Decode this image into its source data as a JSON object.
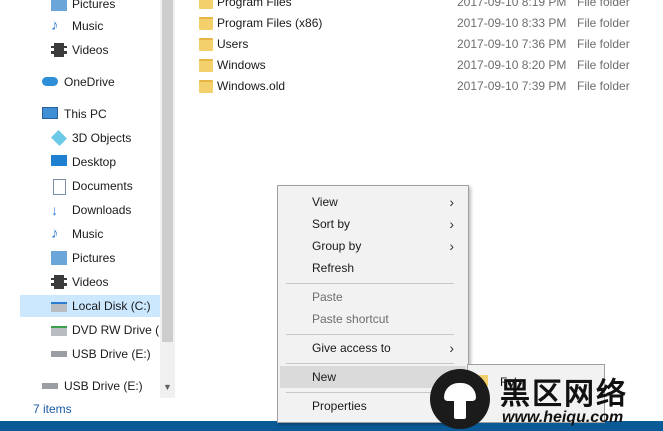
{
  "nav": {
    "items": [
      {
        "label": "Pictures"
      },
      {
        "label": "Music"
      },
      {
        "label": "Videos"
      },
      {
        "label": "OneDrive"
      },
      {
        "label": "This PC"
      },
      {
        "label": "3D Objects"
      },
      {
        "label": "Desktop"
      },
      {
        "label": "Documents"
      },
      {
        "label": "Downloads"
      },
      {
        "label": "Music"
      },
      {
        "label": "Pictures"
      },
      {
        "label": "Videos"
      },
      {
        "label": "Local Disk (C:)"
      },
      {
        "label": "DVD RW Drive (D"
      },
      {
        "label": "USB Drive (E:)"
      },
      {
        "label": "USB Drive (E:)"
      }
    ]
  },
  "files": [
    {
      "name": "Program Files",
      "date": "2017-09-10 8:19 PM",
      "type": "File folder"
    },
    {
      "name": "Program Files (x86)",
      "date": "2017-09-10 8:33 PM",
      "type": "File folder"
    },
    {
      "name": "Users",
      "date": "2017-09-10 7:36 PM",
      "type": "File folder"
    },
    {
      "name": "Windows",
      "date": "2017-09-10 8:20 PM",
      "type": "File folder"
    },
    {
      "name": "Windows.old",
      "date": "2017-09-10 7:39 PM",
      "type": "File folder"
    }
  ],
  "status": {
    "items": "7 items"
  },
  "menu": {
    "view": "View",
    "sort_by": "Sort by",
    "group_by": "Group by",
    "refresh": "Refresh",
    "paste": "Paste",
    "paste_shortcut": "Paste shortcut",
    "give_access": "Give access to",
    "new": "New",
    "properties": "Properties"
  },
  "submenu": {
    "folder": "Fol"
  },
  "watermark": {
    "text": "黑区网络",
    "url": "www.heiqu.com"
  },
  "colors": {
    "selection": "#cce8ff",
    "folder": "#f3d06b",
    "link": "#1a5aa6"
  }
}
